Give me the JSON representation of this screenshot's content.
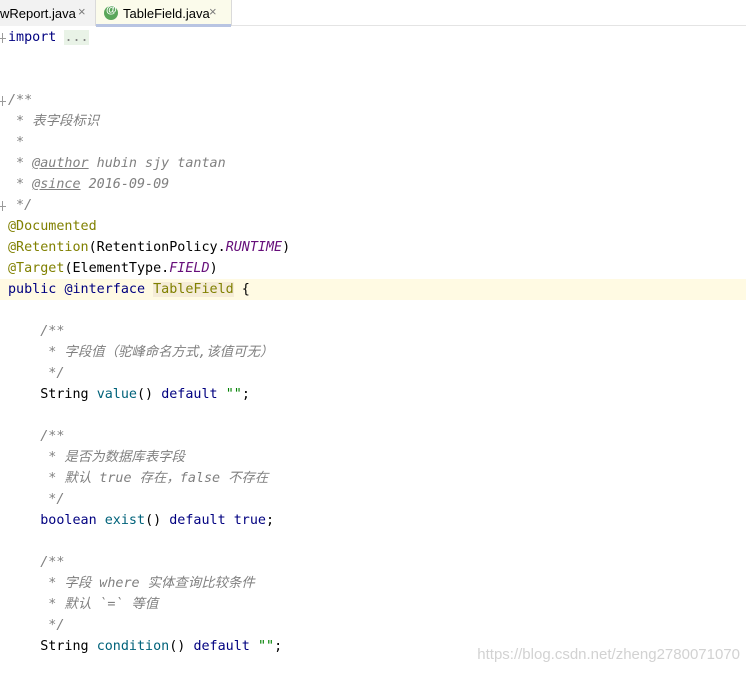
{
  "tabs": [
    {
      "label": "wReport.java",
      "close": "×",
      "active": false
    },
    {
      "label": "TableField.java",
      "close": "×",
      "active": true,
      "icon": "annotation-icon"
    }
  ],
  "code": {
    "l1_import": "import",
    "l1_fold": "...",
    "l4": "/**",
    "l5": " * 表字段标识",
    "l6": " *",
    "l7_pre": " * ",
    "l7_tag": "@author",
    "l7_rest": " hubin sjy tantan",
    "l8_pre": " * ",
    "l8_tag": "@since",
    "l8_rest": " 2016-09-09",
    "l9": " */",
    "l10": "@Documented",
    "l11_ann": "@Retention",
    "l11_a": "(RetentionPolicy.",
    "l11_f": "RUNTIME",
    "l11_b": ")",
    "l12_ann": "@Target",
    "l12_a": "(ElementType.",
    "l12_f": "FIELD",
    "l12_b": ")",
    "l13_kw": "public",
    "l13_sp": " ",
    "l13_ikw": "@interface",
    "l13_sp2": " ",
    "l13_name": "TableField",
    "l13_rest": " {",
    "l15": "    /**",
    "l16": "     * 字段值（驼峰命名方式,该值可无）",
    "l17": "     */",
    "l18_type": "    String ",
    "l18_m": "value",
    "l18_a": "() ",
    "l18_kw": "default",
    "l18_sp": " ",
    "l18_s": "\"\"",
    "l18_e": ";",
    "l20": "    /**",
    "l21": "     * 是否为数据库表字段",
    "l22": "     * 默认 true 存在，false 不存在",
    "l23": "     */",
    "l24_kw": "    boolean",
    "l24_sp": " ",
    "l24_m": "exist",
    "l24_a": "() ",
    "l24_kw2": "default",
    "l24_sp2": " ",
    "l24_kw3": "true",
    "l24_e": ";",
    "l26": "    /**",
    "l27": "     * 字段 where 实体查询比较条件",
    "l28": "     * 默认 `=` 等值",
    "l29": "     */",
    "l30_type": "    String ",
    "l30_m": "condition",
    "l30_a": "() ",
    "l30_kw": "default",
    "l30_sp": " ",
    "l30_s": "\"\"",
    "l30_e": ";"
  },
  "watermark": "https://blog.csdn.net/zheng2780071070"
}
